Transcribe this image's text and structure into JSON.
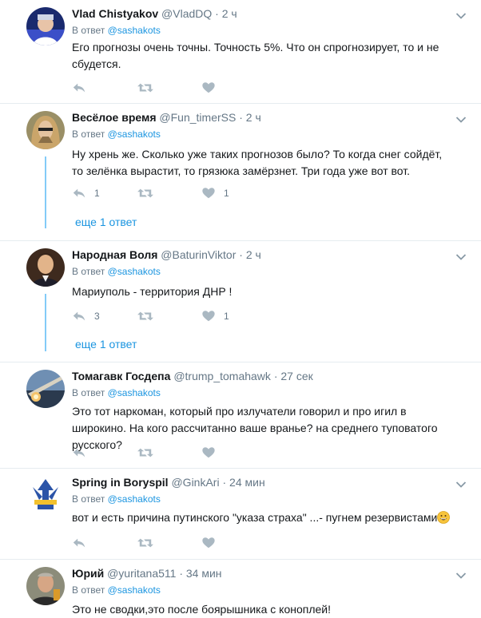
{
  "tweets": [
    {
      "name": "Vlad Chistyakov",
      "handle": "@VladDQ",
      "time": "2 ч",
      "reply_prefix": "В ответ",
      "reply_to": "@sashakots",
      "text": "Его прогнозы очень точны. Точность 5%. Что он спрогнозирует, то и не сбудется.",
      "retweets": "",
      "likes": ""
    },
    {
      "name": "Весёлое время",
      "handle": "@Fun_timerSS",
      "time": "2 ч",
      "reply_prefix": "В ответ",
      "reply_to": "@sashakots",
      "text": "Ну хрень же. Сколько уже таких прогнозов было? То когда снег сойдёт, то зелёнка вырастит, то грязюка замёрзнет. Три года уже вот вот.",
      "replies": "1",
      "likes": "1",
      "more_replies": "еще 1 ответ"
    },
    {
      "name": "Народная Воля",
      "handle": "@BaturinViktor",
      "time": "2 ч",
      "reply_prefix": "В ответ",
      "reply_to": "@sashakots",
      "text": "Мариуполь - территория ДНР !",
      "replies": "3",
      "likes": "1",
      "more_replies": "еще 1 ответ"
    },
    {
      "name": "Томагавк Госдепа",
      "handle": "@trump_tomahawk",
      "time": "27 сек",
      "reply_prefix": "В ответ",
      "reply_to": "@sashakots",
      "text": "Это тот наркоман, который про излучатели говорил и про игил в широкино. На кого рассчитанно ваше вранье? на среднего туповатого русского?"
    },
    {
      "name": "Spring in Boryspil",
      "handle": "@GinkAri",
      "time": "24 мин",
      "reply_prefix": "В ответ",
      "reply_to": "@sashakots",
      "text": "вот и есть причина путинского \"указа страха\" ...- пугнем резервистами"
    },
    {
      "name": "Юрий",
      "handle": "@yuritana511",
      "time": "34 мин",
      "reply_prefix": "В ответ",
      "reply_to": "@sashakots",
      "text": "Это не сводки,это после боярышника с коноплей!"
    }
  ],
  "separator": "·",
  "icons": {
    "reply": "reply-icon",
    "retweet": "retweet-icon",
    "like": "heart-icon",
    "menu": "chevron-down-icon",
    "emoji": "grinning-face-emoji"
  },
  "colors": {
    "link": "#1b95e0",
    "muted": "#657786",
    "text": "#14171a",
    "thread": "#1da1f2",
    "divider": "#e6ecf0"
  }
}
